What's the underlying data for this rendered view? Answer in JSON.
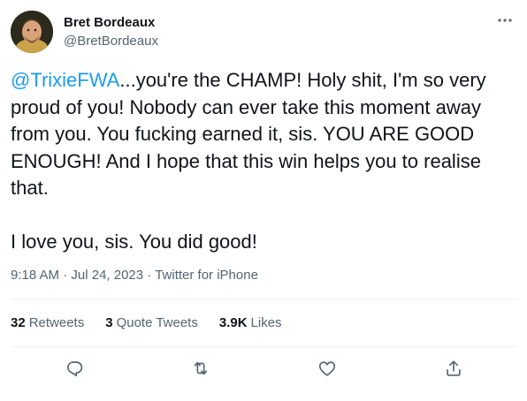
{
  "author": {
    "name": "Bret Bordeaux",
    "handle": "@BretBordeaux"
  },
  "tweet": {
    "mention": "@TrixieFWA",
    "text_p1_rest": "...you're the CHAMP! Holy shit, I'm so very proud of you! Nobody can ever take this moment away from you. You fucking earned it, sis. YOU ARE GOOD ENOUGH! And I hope that this win helps you to realise that.",
    "text_p2": "I love you, sis. You did good!"
  },
  "meta": {
    "time": "9:18 AM",
    "separator": "·",
    "date": "Jul 24, 2023",
    "source": "Twitter for iPhone"
  },
  "stats": {
    "retweets_count": "32",
    "retweets_label": "Retweets",
    "quotes_count": "3",
    "quotes_label": "Quote Tweets",
    "likes_count": "3.9K",
    "likes_label": "Likes"
  },
  "actions": {
    "reply_icon": "reply-icon",
    "retweet_icon": "retweet-icon",
    "like_icon": "heart-icon",
    "share_icon": "share-icon"
  },
  "colors": {
    "accent": "#1d9bf0",
    "text": "#0f1419",
    "secondary": "#536471",
    "divider": "#eff3f4"
  }
}
